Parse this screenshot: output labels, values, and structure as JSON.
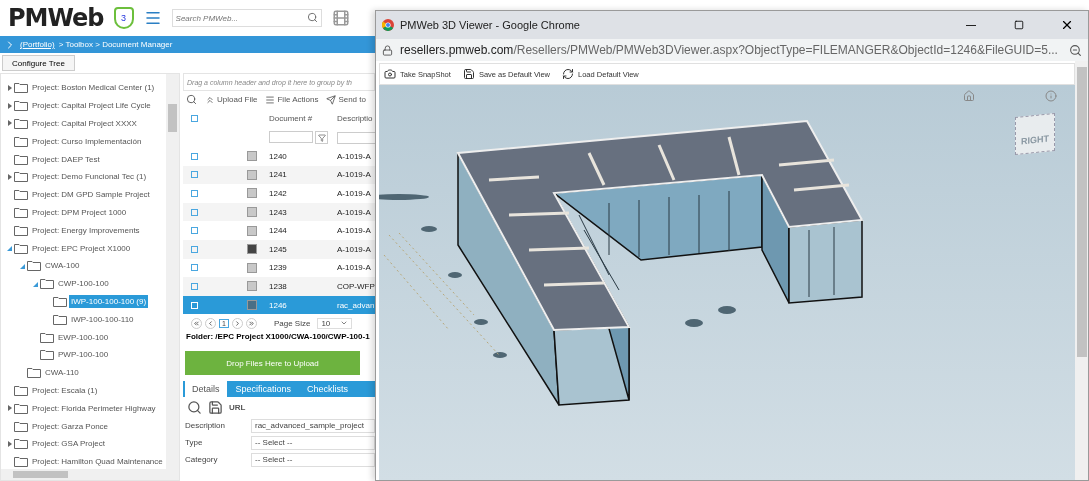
{
  "app": {
    "logo": "PMWeb",
    "badge": "3",
    "search": {
      "placeholder": "Search PMWeb..."
    },
    "breadcrumb": {
      "link": "(Portfolio)",
      "rest": "> Toolbox > Document Manager"
    },
    "configure_button": "Configure Tree",
    "tree": [
      {
        "label": "Project: Boston Medical Center (1)",
        "kind": "collapsed",
        "selected": false
      },
      {
        "label": "Project: Capital Project Life Cycle",
        "kind": "collapsed",
        "selected": false
      },
      {
        "label": "Project: Capital Project XXXX",
        "kind": "collapsed",
        "selected": false
      },
      {
        "label": "Project: Curso Implementación",
        "kind": "leaf",
        "selected": false
      },
      {
        "label": "Project: DAEP Test",
        "kind": "leaf",
        "selected": false
      },
      {
        "label": "Project: Demo Funcional Tec (1)",
        "kind": "collapsed",
        "selected": false
      },
      {
        "label": "Project: DM GPD Sample Project",
        "kind": "leaf",
        "selected": false
      },
      {
        "label": "Project: DPM Project 1000",
        "kind": "leaf",
        "selected": false
      },
      {
        "label": "Project: Energy Improvements",
        "kind": "leaf",
        "selected": false
      },
      {
        "label": "Project: EPC Project X1000",
        "kind": "expanded",
        "selected": false,
        "children": [
          {
            "label": "CWA-100",
            "kind": "expanded",
            "selected": false,
            "children": [
              {
                "label": "CWP-100-100",
                "kind": "expanded",
                "selected": false,
                "children": [
                  {
                    "label": "IWP-100-100-100 (9)",
                    "kind": "leaf",
                    "selected": true
                  },
                  {
                    "label": "IWP-100-100-110",
                    "kind": "leaf",
                    "selected": false
                  }
                ]
              },
              {
                "label": "EWP-100-100",
                "kind": "leaf",
                "selected": false
              },
              {
                "label": "PWP-100-100",
                "kind": "leaf",
                "selected": false
              }
            ]
          },
          {
            "label": "CWA-110",
            "kind": "leaf",
            "selected": false
          }
        ]
      },
      {
        "label": "Project: Escala (1)",
        "kind": "leaf",
        "selected": false
      },
      {
        "label": "Project: Florida Perimeter Highway",
        "kind": "collapsed",
        "selected": false
      },
      {
        "label": "Project: Garza Ponce",
        "kind": "leaf",
        "selected": false
      },
      {
        "label": "Project: GSA Project",
        "kind": "collapsed",
        "selected": false
      },
      {
        "label": "Project: Hamilton Quad Maintenance",
        "kind": "leaf",
        "selected": false
      }
    ],
    "grid": {
      "group_hint": "Drag a column header and drop it here to group by th",
      "toolbar": [
        {
          "label": "Upload File",
          "kind": "upload"
        },
        {
          "label": "File Actions",
          "kind": "actions"
        },
        {
          "label": "Send to",
          "kind": "send"
        }
      ],
      "header_checked": false,
      "columns": [
        "Document #",
        "Descriptio"
      ],
      "rows": [
        {
          "number": "1240",
          "description": "A-1019-A",
          "kind": "image",
          "checked": false,
          "selected": false
        },
        {
          "number": "1241",
          "description": "A-1019-A",
          "kind": "image",
          "checked": false,
          "selected": false
        },
        {
          "number": "1242",
          "description": "A-1019-A",
          "kind": "image",
          "checked": false,
          "selected": false
        },
        {
          "number": "1243",
          "description": "A-1019-A",
          "kind": "image",
          "checked": false,
          "selected": false
        },
        {
          "number": "1244",
          "description": "A-1019-A",
          "kind": "image",
          "checked": false,
          "selected": false
        },
        {
          "number": "1245",
          "description": "A-1019-A",
          "kind": "dark",
          "checked": false,
          "selected": false
        },
        {
          "number": "1239",
          "description": "A-1019-A",
          "kind": "image",
          "checked": false,
          "selected": false
        },
        {
          "number": "1238",
          "description": "COP-WFP",
          "kind": "image",
          "checked": false,
          "selected": false
        },
        {
          "number": "1246",
          "description": "rac_advan",
          "kind": "model",
          "checked": false,
          "selected": true
        }
      ],
      "pager": {
        "page": "1",
        "page_size_label": "Page Size",
        "page_size": "10"
      }
    },
    "folder": "Folder: /EPC Project X1000/CWA-100/CWP-100-1",
    "upload": "Drop Files Here to Upload",
    "tabs": [
      {
        "label": "Details",
        "selected": true
      },
      {
        "label": "Specifications",
        "selected": false
      },
      {
        "label": "Checklists",
        "selected": false
      }
    ],
    "detail_toolbar": "URL",
    "fields": [
      {
        "label": "Description",
        "value": "rac_advanced_sample_project"
      },
      {
        "label": "Type",
        "value": "-- Select --"
      },
      {
        "label": "Category",
        "value": "-- Select --"
      }
    ]
  },
  "browser": {
    "title": "PMWeb 3D Viewer - Google Chrome",
    "url_host": "resellers.pmweb.com",
    "url_path": "/Resellers/PMWeb/PMWeb3DViewer.aspx?ObjectType=FILEMANGER&ObjectId=1246&FileGUID=5...",
    "toolbar": [
      {
        "label": "Take SnapShot",
        "kind": "camera"
      },
      {
        "label": "Save as Default View",
        "kind": "save"
      },
      {
        "label": "Load Default View",
        "kind": "refresh"
      }
    ],
    "view_cube": "RIGHT"
  }
}
